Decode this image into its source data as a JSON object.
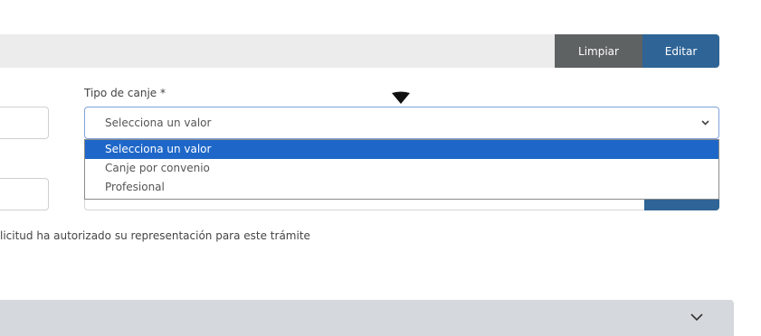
{
  "toolbar": {
    "clear_label": "Limpiar",
    "edit_label": "Editar"
  },
  "form": {
    "tipo_canje": {
      "label": "Tipo de canje *",
      "selected_value": "Selecciona un valor",
      "options": [
        "Selecciona un valor",
        "Canje por convenio",
        "Profesional"
      ]
    },
    "note": "licitud ha autorizado su representación para este trámite"
  },
  "icons": {
    "cursor": "pointer-triangle-icon",
    "select_chevron": "chevron-down-icon",
    "accordion_chevron": "chevron-down-icon"
  },
  "colors": {
    "primary": "#2f6496",
    "secondary_button": "#5e6262",
    "dropdown_highlight": "#1e67c9",
    "accordion_bg": "#d5d9dd"
  }
}
